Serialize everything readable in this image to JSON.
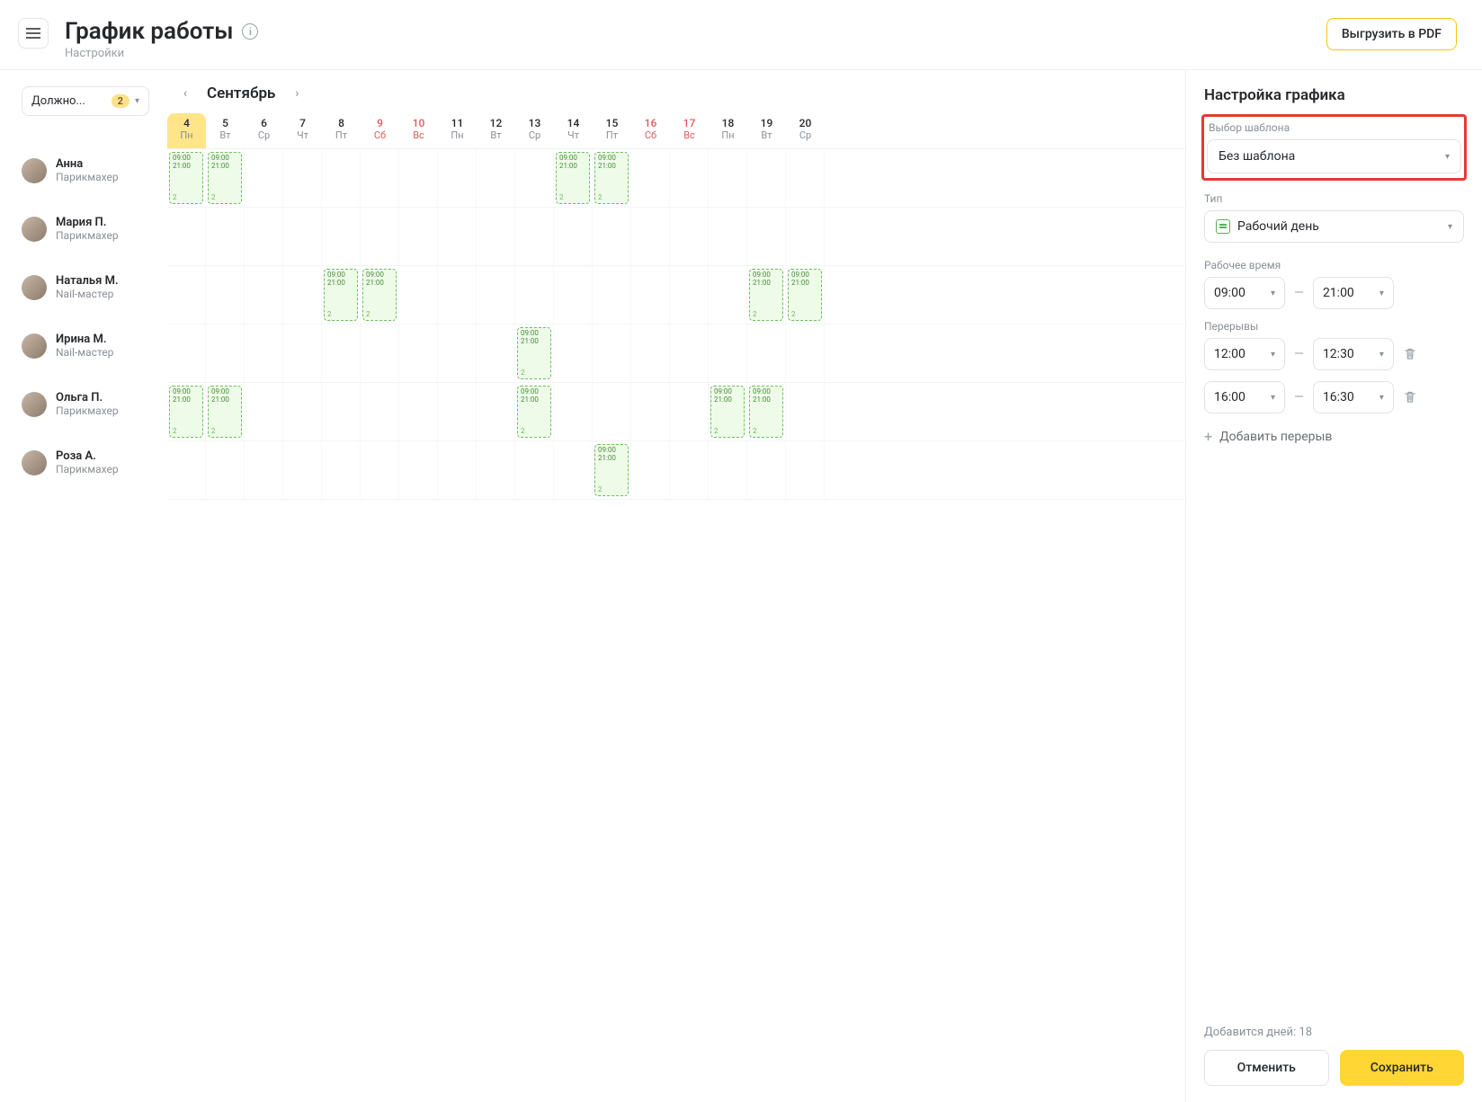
{
  "header": {
    "title": "График работы",
    "subtitle": "Настройки",
    "export": "Выгрузить в PDF"
  },
  "filter": {
    "label": "Должно...",
    "badge": "2"
  },
  "employees": [
    {
      "name": "Анна",
      "role": "Парикмахер"
    },
    {
      "name": "Мария П.",
      "role": "Парикмахер"
    },
    {
      "name": "Наталья М.",
      "role": "Nail-мастер"
    },
    {
      "name": "Ирина М.",
      "role": "Nail-мастер"
    },
    {
      "name": "Ольга П.",
      "role": "Парикмахер"
    },
    {
      "name": "Роза А.",
      "role": "Парикмахер"
    }
  ],
  "calendar": {
    "month": "Сентябрь",
    "days": [
      {
        "n": "4",
        "d": "Пн",
        "sel": true
      },
      {
        "n": "5",
        "d": "Вт"
      },
      {
        "n": "6",
        "d": "Ср"
      },
      {
        "n": "7",
        "d": "Чт"
      },
      {
        "n": "8",
        "d": "Пт"
      },
      {
        "n": "9",
        "d": "Сб",
        "we": true
      },
      {
        "n": "10",
        "d": "Вс",
        "we": true
      },
      {
        "n": "11",
        "d": "Пн"
      },
      {
        "n": "12",
        "d": "Вт"
      },
      {
        "n": "13",
        "d": "Ср"
      },
      {
        "n": "14",
        "d": "Чт"
      },
      {
        "n": "15",
        "d": "Пт"
      },
      {
        "n": "16",
        "d": "Сб",
        "we": true
      },
      {
        "n": "17",
        "d": "Вс",
        "we": true
      },
      {
        "n": "18",
        "d": "Пн"
      },
      {
        "n": "19",
        "d": "Вт"
      },
      {
        "n": "20",
        "d": "Ср"
      }
    ],
    "shift": {
      "t1": "09:00",
      "t2": "21:00",
      "b": "2"
    },
    "shifts": [
      [
        0,
        1,
        10,
        11
      ],
      [],
      [
        4,
        5,
        15,
        16
      ],
      [
        9
      ],
      [
        0,
        1,
        9,
        14,
        15
      ],
      [
        11
      ]
    ]
  },
  "panel": {
    "title": "Настройка графика",
    "template_label": "Выбор шаблона",
    "template_value": "Без шаблона",
    "type_label": "Тип",
    "type_value": "Рабочий день",
    "work_label": "Рабочее время",
    "work_from": "09:00",
    "work_to": "21:00",
    "breaks_label": "Перерывы",
    "breaks": [
      {
        "from": "12:00",
        "to": "12:30"
      },
      {
        "from": "16:00",
        "to": "16:30"
      }
    ],
    "add_break": "Добавить перерыв",
    "days_info": "Добавится дней: 18",
    "cancel": "Отменить",
    "save": "Сохранить"
  }
}
